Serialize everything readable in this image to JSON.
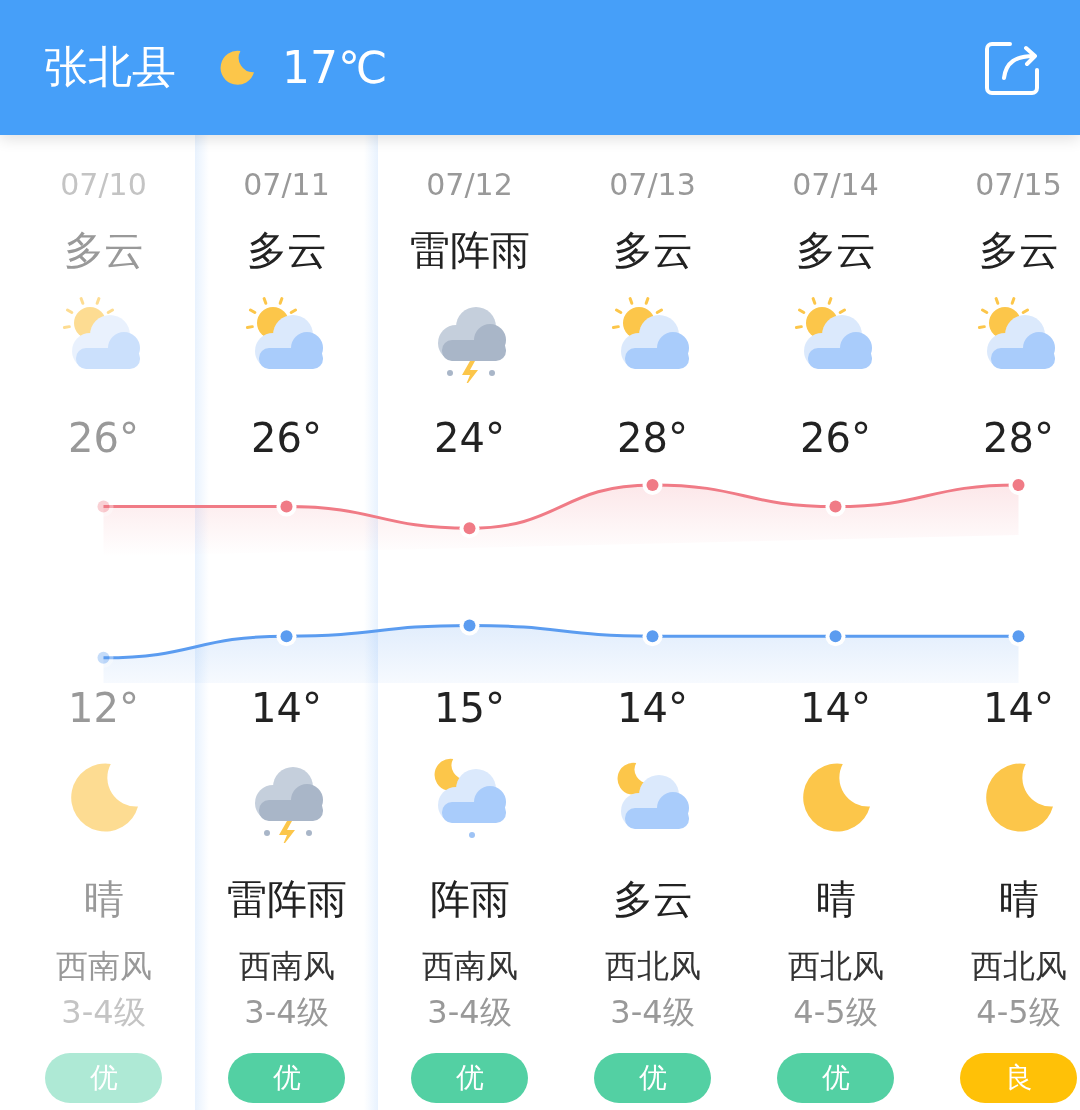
{
  "header": {
    "city": "张北县",
    "temperature": "17℃"
  },
  "days": [
    {
      "past": true,
      "selected": false,
      "day": {
        "weather": "多云",
        "kind": "sun-cloud"
      },
      "night": {
        "kind": "moon",
        "weather": "晴"
      },
      "wind_direction": "西南风",
      "wind_level": "3-4级",
      "aqi": {
        "label": "优",
        "color": "#aee9d5"
      }
    },
    {
      "past": false,
      "selected": true,
      "day": {
        "weather": "多云",
        "kind": "sun-cloud"
      },
      "night": {
        "kind": "thunder",
        "weather": "雷阵雨"
      },
      "wind_direction": "西南风",
      "wind_level": "3-4级",
      "aqi": {
        "label": "优",
        "color": "#53d0a3"
      }
    },
    {
      "past": false,
      "selected": false,
      "day": {
        "weather": "雷阵雨",
        "kind": "thunder"
      },
      "night": {
        "kind": "moon-cloud-rain",
        "weather": "阵雨"
      },
      "wind_direction": "西南风",
      "wind_level": "3-4级",
      "aqi": {
        "label": "优",
        "color": "#53d0a3"
      }
    },
    {
      "past": false,
      "selected": false,
      "day": {
        "weather": "多云",
        "kind": "sun-cloud"
      },
      "night": {
        "kind": "moon-cloud",
        "weather": "多云"
      },
      "wind_direction": "西北风",
      "wind_level": "3-4级",
      "aqi": {
        "label": "优",
        "color": "#53d0a3"
      }
    },
    {
      "past": false,
      "selected": false,
      "day": {
        "weather": "多云",
        "kind": "sun-cloud"
      },
      "night": {
        "kind": "moon",
        "weather": "晴"
      },
      "wind_direction": "西北风",
      "wind_level": "4-5级",
      "aqi": {
        "label": "优",
        "color": "#53d0a3"
      }
    },
    {
      "past": false,
      "selected": false,
      "day": {
        "weather": "多云",
        "kind": "sun-cloud"
      },
      "night": {
        "kind": "moon",
        "weather": "晴"
      },
      "wind_direction": "西北风",
      "wind_level": "4-5级",
      "aqi": {
        "label": "良",
        "color": "#ffc107"
      }
    }
  ],
  "temperature_chart": {
    "chart_data": {
      "type": "line",
      "categories": [
        "07/10",
        "07/11",
        "07/12",
        "07/13",
        "07/14",
        "07/15"
      ],
      "series": [
        {
          "color": "#f07b86",
          "marker": "circle",
          "values": [
            26,
            26,
            24,
            28,
            26,
            28
          ],
          "value_labels": [
            "26°",
            "26°",
            "24°",
            "28°",
            "26°",
            "28°"
          ]
        },
        {
          "color": "#5b9cf0",
          "marker": "circle",
          "values": [
            12,
            14,
            15,
            14,
            14,
            14
          ],
          "value_labels": [
            "12°",
            "14°",
            "15°",
            "14°",
            "14°",
            "14°"
          ]
        }
      ]
    }
  }
}
